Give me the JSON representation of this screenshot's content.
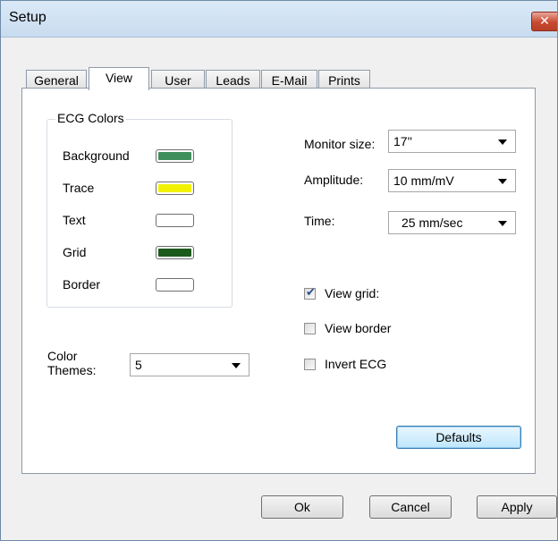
{
  "window": {
    "title": "Setup",
    "close_label": "✕"
  },
  "tabs": [
    "General",
    "View",
    "User",
    "Leads",
    "E-Mail",
    "Prints"
  ],
  "active_tab": "View",
  "ecg_colors": {
    "legend": "ECG Colors",
    "items": [
      {
        "label": "Background",
        "color": "#3f8f5c"
      },
      {
        "label": "Trace",
        "color": "#f2f200"
      },
      {
        "label": "Text",
        "color": "#ffffff"
      },
      {
        "label": "Grid",
        "color": "#1c5a1c"
      },
      {
        "label": "Border",
        "color": "#ffffff"
      }
    ]
  },
  "color_themes": {
    "label_line1": "Color",
    "label_line2": "Themes:",
    "value": "5"
  },
  "monitor_size": {
    "label": "Monitor size:",
    "value": "17''"
  },
  "amplitude": {
    "label": "Amplitude:",
    "value": "10 mm/mV"
  },
  "time": {
    "label": "Time:",
    "value": "25  mm/sec"
  },
  "checkboxes": [
    {
      "label": "View grid:",
      "checked": true
    },
    {
      "label": "View border",
      "checked": false
    },
    {
      "label": "Invert ECG",
      "checked": false
    }
  ],
  "buttons": {
    "defaults": "Defaults",
    "ok": "Ok",
    "cancel": "Cancel",
    "apply": "Apply"
  }
}
